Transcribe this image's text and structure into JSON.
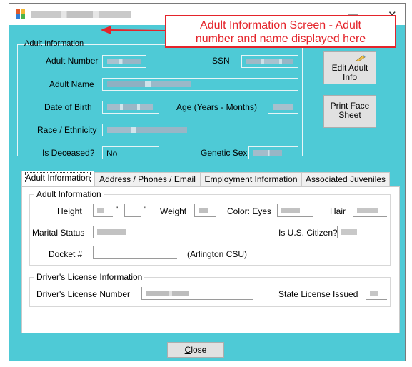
{
  "window": {
    "minimize_glyph": "—",
    "close_glyph": "✕"
  },
  "callout": {
    "line1": "Adult Information Screen - Adult",
    "line2": "number and name displayed here"
  },
  "adult_info_group": {
    "title": "Adult Information",
    "adult_number_label": "Adult Number",
    "ssn_label": "SSN",
    "adult_name_label": "Adult Name",
    "dob_label": "Date of Birth",
    "age_label": "Age (Years - Months)",
    "race_label": "Race / Ethnicity",
    "deceased_label": "Is Deceased?",
    "deceased_value": "No",
    "genetic_sex_label": "Genetic Sex"
  },
  "buttons": {
    "edit_adult_info_line1": "Edit Adult",
    "edit_adult_info_line2": "Info",
    "print_face_sheet_line1": "Print Face",
    "print_face_sheet_line2": "Sheet",
    "close_label_rest": "lose",
    "close_label_mnemonic": "C"
  },
  "tabs": [
    {
      "label": "Adult Information"
    },
    {
      "label": "Address / Phones / Email"
    },
    {
      "label": "Employment Information"
    },
    {
      "label": "Associated Juveniles"
    }
  ],
  "tab_adult": {
    "group_title": "Adult Information",
    "height_label": "Height",
    "feet_mark": "'",
    "inch_mark": "\"",
    "weight_label": "Weight",
    "eyes_label": "Color: Eyes",
    "hair_label": "Hair",
    "marital_label": "Marital Status",
    "citizen_label": "Is U.S. Citizen?",
    "docket_label": "Docket #",
    "csu_text": "(Arlington CSU)"
  },
  "drivers_license": {
    "group_title": "Driver's License Information",
    "number_label": "Driver's License Number",
    "state_label": "State License Issued"
  },
  "colors": {
    "background": "#4ecad6",
    "callout": "#e4242b"
  },
  "icons": [
    "app-icon",
    "minimize-icon",
    "close-icon",
    "pencil-icon"
  ]
}
